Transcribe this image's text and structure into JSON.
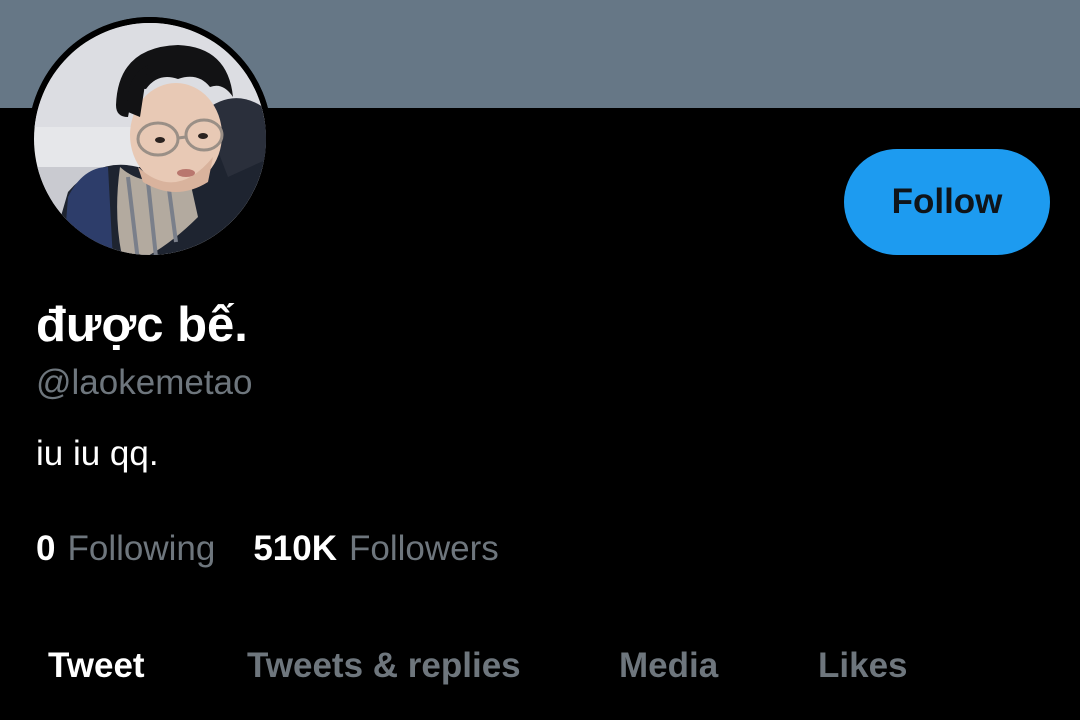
{
  "profile": {
    "display_name": "được bế.",
    "handle": "@laokemetao",
    "bio": "iu iu qq."
  },
  "actions": {
    "follow_label": "Follow"
  },
  "stats": {
    "following_count": "0",
    "following_label": "Following",
    "followers_count": "510K",
    "followers_label": "Followers"
  },
  "tabs": [
    {
      "label": "Tweet",
      "active": true
    },
    {
      "label": "Tweets & replies",
      "active": false
    },
    {
      "label": "Media",
      "active": false
    },
    {
      "label": "Likes",
      "active": false
    }
  ],
  "colors": {
    "banner": "#667786",
    "background": "#000000",
    "accent": "#1d9bf0",
    "muted_text": "#6e767d",
    "primary_text": "#ffffff"
  }
}
